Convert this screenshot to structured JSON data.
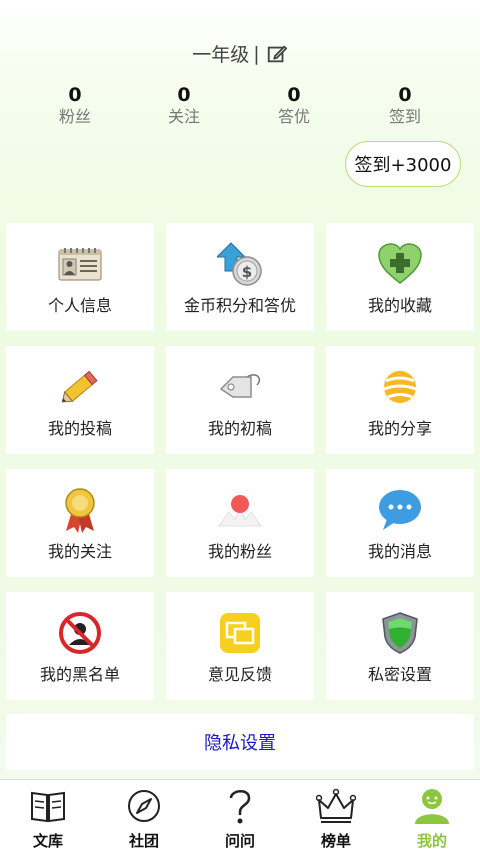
{
  "profile": {
    "grade": "一年级",
    "separator": "|"
  },
  "stats": [
    {
      "value": "0",
      "label": "粉丝"
    },
    {
      "value": "0",
      "label": "关注"
    },
    {
      "value": "0",
      "label": "答优"
    },
    {
      "value": "0",
      "label": "签到"
    }
  ],
  "signin_label": "签到+3000",
  "tiles": [
    {
      "label": "个人信息",
      "icon": "id-card-icon"
    },
    {
      "label": "金币积分和答优",
      "icon": "coin-upload-icon"
    },
    {
      "label": "我的收藏",
      "icon": "heart-plus-icon"
    },
    {
      "label": "我的投稿",
      "icon": "pencil-icon"
    },
    {
      "label": "我的初稿",
      "icon": "tag-icon"
    },
    {
      "label": "我的分享",
      "icon": "yellow-ball-icon"
    },
    {
      "label": "我的关注",
      "icon": "medal-icon"
    },
    {
      "label": "我的粉丝",
      "icon": "fans-pin-icon"
    },
    {
      "label": "我的消息",
      "icon": "chat-bubble-icon"
    },
    {
      "label": "我的黑名单",
      "icon": "blacklist-icon"
    },
    {
      "label": "意见反馈",
      "icon": "feedback-icon"
    },
    {
      "label": "私密设置",
      "icon": "shield-icon"
    }
  ],
  "privacy_link": "隐私设置",
  "tabs": [
    {
      "label": "文库",
      "icon": "book-icon",
      "active": false
    },
    {
      "label": "社团",
      "icon": "compass-icon",
      "active": false
    },
    {
      "label": "问问",
      "icon": "question-icon",
      "active": false
    },
    {
      "label": "榜单",
      "icon": "crown-icon",
      "active": false
    },
    {
      "label": "我的",
      "icon": "user-icon",
      "active": true
    }
  ],
  "colors": {
    "accent": "#8cc63f",
    "link": "#1a1ac8",
    "signin_border": "#b6e07a"
  }
}
